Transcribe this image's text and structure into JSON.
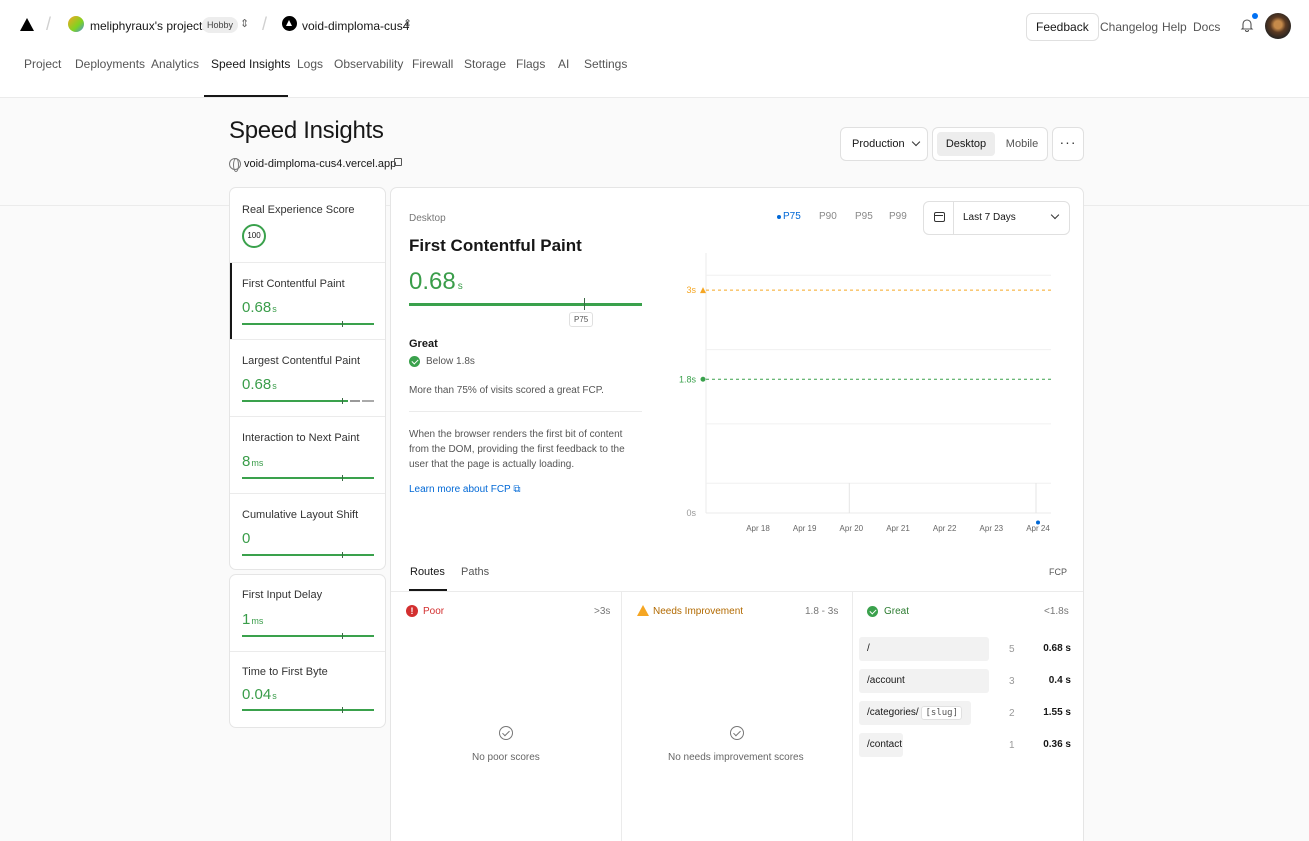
{
  "nav": {
    "team_name": "meliphyraux's projects",
    "plan_badge": "Hobby",
    "project_name": "void-dimploma-cus4",
    "feedback": "Feedback",
    "changelog": "Changelog",
    "help": "Help",
    "docs": "Docs",
    "tabs": [
      "Project",
      "Deployments",
      "Analytics",
      "Speed Insights",
      "Logs",
      "Observability",
      "Firewall",
      "Storage",
      "Flags",
      "AI",
      "Settings"
    ],
    "active_tab": "Speed Insights"
  },
  "header": {
    "title": "Speed Insights",
    "site": "void-dimploma-cus4.vercel.app",
    "environment": "Production",
    "device_on": "Desktop",
    "device_off": "Mobile",
    "more": "···"
  },
  "metrics": {
    "res_label": "Real Experience Score",
    "res_value": "100",
    "items": [
      {
        "label": "First Contentful Paint",
        "value": "0.68",
        "unit": "s"
      },
      {
        "label": "Largest Contentful Paint",
        "value": "0.68",
        "unit": "s"
      },
      {
        "label": "Interaction to Next Paint",
        "value": "8",
        "unit": "ms"
      },
      {
        "label": "Cumulative Layout Shift",
        "value": "0",
        "unit": ""
      },
      {
        "label": "First Input Delay",
        "value": "1",
        "unit": "ms"
      },
      {
        "label": "Time to First Byte",
        "value": "0.04",
        "unit": "s"
      }
    ]
  },
  "detail": {
    "device": "Desktop",
    "title": "First Contentful Paint",
    "value": "0.68",
    "unit": "s",
    "marker": "P75",
    "rating": "Great",
    "threshold": "Below 1.8s",
    "summary": "More than 75% of visits scored a great FCP.",
    "description": "When the browser renders the first bit of content from the DOM, providing the first feedback to the user that the page is actually loading.",
    "learn_more": "Learn more about FCP",
    "percentiles": [
      "P75",
      "P90",
      "P95",
      "P99"
    ],
    "selected_percentile": "P75",
    "range": "Last 7 Days"
  },
  "chart_data": {
    "type": "scatter",
    "x": [
      "Apr 18",
      "Apr 19",
      "Apr 20",
      "Apr 21",
      "Apr 22",
      "Apr 23",
      "Apr 24"
    ],
    "y_ticks": [
      "0s",
      "1.8s",
      "3s"
    ],
    "thresholds": [
      {
        "label": "3s",
        "value": 3,
        "color": "#f5a623"
      },
      {
        "label": "1.8s",
        "value": 1.8,
        "color": "#3aa14c"
      }
    ],
    "points": [
      {
        "x": "Apr 24",
        "y": 0.68
      }
    ],
    "ylim": [
      0,
      3.5
    ],
    "grid": true
  },
  "routes": {
    "tabs": [
      "Routes",
      "Paths"
    ],
    "metric": "FCP",
    "poor": {
      "label": "Poor",
      "range": ">3s",
      "empty": "No poor scores"
    },
    "needs": {
      "label": "Needs Improvement",
      "range": "1.8 - 3s",
      "empty": "No needs improvement scores"
    },
    "great": {
      "label": "Great",
      "range": "<1.8s"
    },
    "rows": [
      {
        "route": "/",
        "count": "5",
        "value": "0.68 s"
      },
      {
        "route": "/account",
        "count": "3",
        "value": "0.4 s"
      },
      {
        "route": "/categories/",
        "slug": "[slug]",
        "count": "2",
        "value": "1.55 s"
      },
      {
        "route": "/contact",
        "count": "1",
        "value": "0.36 s"
      }
    ]
  }
}
